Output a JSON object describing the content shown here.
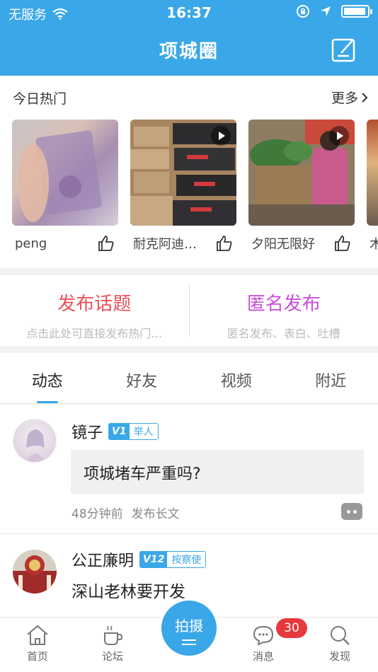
{
  "status_bar": {
    "carrier": "无服务",
    "time": "16:37",
    "battery_level": 0.95
  },
  "nav": {
    "title": "项城圈",
    "compose_icon": "compose-icon"
  },
  "hot": {
    "title": "今日热门",
    "more_label": "更多",
    "cards": [
      {
        "label": "peng",
        "is_video": false
      },
      {
        "label": "耐克阿迪…",
        "is_video": true
      },
      {
        "label": "夕阳无限好",
        "is_video": true
      },
      {
        "label": "木",
        "is_video": false
      }
    ]
  },
  "publish": {
    "topic_title": "发布话题",
    "topic_subtitle": "点击此处可直接发布热门…",
    "anon_title": "匿名发布",
    "anon_subtitle": "匿名发布、表白、吐槽",
    "topic_color": "#e9505a",
    "anon_color": "#c84fd8"
  },
  "tabs": [
    "动态",
    "好友",
    "视频",
    "附近"
  ],
  "feed": [
    {
      "author": "镜子",
      "level": "V1",
      "rank": "举人",
      "content": "项城堵车严重吗?",
      "time": "48分钟前",
      "action": "发布长文"
    },
    {
      "author": "公正廉明",
      "level": "V12",
      "rank": "按察使",
      "content": "深山老林要开发"
    }
  ],
  "tabbar": {
    "home": "首页",
    "forum": "论坛",
    "shoot": "拍摄",
    "messages": "消息",
    "messages_count": "30",
    "discover": "发现"
  },
  "colors": {
    "primary": "#3aa7e8",
    "badge_red": "#e6393b"
  }
}
